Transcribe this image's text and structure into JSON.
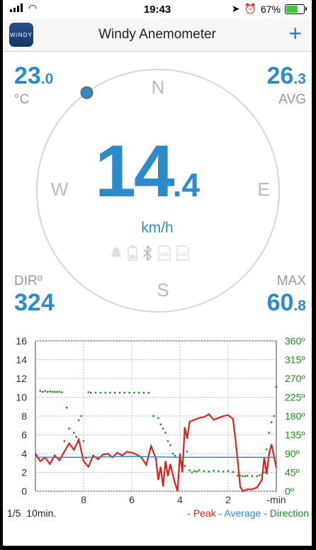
{
  "status": {
    "time": "19:43",
    "battery": "67%",
    "battery_level": 0.67
  },
  "header": {
    "app_icon": "WINDY",
    "title": "Windy Anemometer",
    "add": "+"
  },
  "readings": {
    "temp_int": "23",
    "temp_dec": ".0",
    "temp_unit": "°C",
    "avg_int": "26",
    "avg_dec": ".3",
    "avg_label": "AVG",
    "speed_int": "14",
    "speed_dec": ".4",
    "speed_unit": "km/h",
    "dir_label": "DIRº",
    "dir_value": "324",
    "max_label": "MAX",
    "max_int": "60",
    "max_dec": ".8",
    "direction_deg": 324
  },
  "compass": {
    "n": "N",
    "e": "E",
    "s": "S",
    "w": "W"
  },
  "status_icons": [
    "bell-icon",
    "battery-icon",
    "bluetooth-icon",
    "live-icon",
    "log-icon"
  ],
  "colors": {
    "accent": "#2e8bc9",
    "peak": "#e02020",
    "average": "#2e8bc9",
    "direction": "#1a8a1a"
  },
  "chart_data": {
    "type": "line",
    "x_label": "-min",
    "xlim": [
      -10,
      0
    ],
    "ylim_left": [
      0,
      16
    ],
    "ylim_right": [
      0,
      360
    ],
    "left_ticks": [
      "0",
      "2",
      "4",
      "6",
      "8",
      "10",
      "12",
      "14",
      "16"
    ],
    "right_ticks": [
      "0º",
      "45º",
      "90º",
      "135º",
      "180º",
      "225º",
      "270º",
      "315º",
      "360º"
    ],
    "x_ticks": [
      {
        "v": -8,
        "l": "8"
      },
      {
        "v": -6,
        "l": "6"
      },
      {
        "v": -4,
        "l": "4"
      },
      {
        "v": -2,
        "l": "2"
      },
      {
        "v": 0,
        "l": "-min"
      }
    ],
    "series": [
      {
        "name": "Peak",
        "color": "#e02020",
        "x": [
          -10,
          -9.8,
          -9.6,
          -9.4,
          -9.2,
          -9.0,
          -8.8,
          -8.6,
          -8.4,
          -8.2,
          -8.0,
          -7.8,
          -7.6,
          -7.4,
          -7.2,
          -7.0,
          -6.8,
          -6.6,
          -6.4,
          -6.2,
          -6.0,
          -5.8,
          -5.6,
          -5.4,
          -5.2,
          -5.0,
          -4.9,
          -4.8,
          -4.7,
          -4.6,
          -4.5,
          -4.4,
          -4.3,
          -4.2,
          -4.1,
          -4.0,
          -3.9,
          -3.8,
          -3.7,
          -3.6,
          -3.4,
          -3.2,
          -3.0,
          -2.8,
          -2.6,
          -2.4,
          -2.2,
          -2.0,
          -1.8,
          -1.7,
          -1.6,
          -1.5,
          -1.4,
          -1.2,
          -1.0,
          -0.8,
          -0.6,
          -0.5,
          -0.4,
          -0.3,
          -0.2,
          0
        ],
        "y": [
          4,
          3.2,
          3.6,
          2.9,
          3.8,
          3.3,
          4.2,
          5.1,
          4.4,
          5.5,
          3.2,
          2.6,
          3.8,
          3.4,
          3.9,
          4.0,
          3.6,
          4.1,
          3.8,
          4.2,
          4.1,
          3.9,
          3.6,
          2.8,
          4.8,
          3.5,
          1.2,
          2.6,
          0.5,
          3.2,
          1.6,
          2.9,
          1.8,
          0.8,
          0,
          4.0,
          2.0,
          6.8,
          5.6,
          7.4,
          7.6,
          7.8,
          7.9,
          8.2,
          7.6,
          7.8,
          8.0,
          8.1,
          7.7,
          5.6,
          3.2,
          0.5,
          0,
          0.2,
          0.2,
          0.4,
          1.2,
          3.6,
          1.8,
          4.0,
          5.0,
          2.5
        ]
      },
      {
        "name": "Average",
        "color": "#2e8bc9",
        "x": [
          -10,
          -8,
          -6,
          -4,
          -2,
          0
        ],
        "y": [
          3.6,
          3.6,
          3.7,
          3.6,
          3.6,
          3.6
        ]
      },
      {
        "name": "Direction",
        "color": "#1a8a1a",
        "x": [
          -9.8,
          -9.7,
          -9.6,
          -9.5,
          -9.4,
          -9.3,
          -9.2,
          -9.1,
          -9.0,
          -8.9,
          -8.8,
          -8.7,
          -8.6,
          -8.4,
          -8.3,
          -8.2,
          -8.1,
          -8.0,
          -7.9,
          -7.8,
          -7.7,
          -7.5,
          -7.3,
          -7.1,
          -6.9,
          -6.7,
          -6.5,
          -6.3,
          -6.1,
          -5.9,
          -5.7,
          -5.5,
          -5.3,
          -5.1,
          -4.9,
          -4.8,
          -4.7,
          -4.6,
          -4.5,
          -4.4,
          -4.3,
          -4.2,
          -4.0,
          -3.9,
          -3.8,
          -3.7,
          -3.6,
          -3.5,
          -3.4,
          -3.3,
          -3.2,
          -3.0,
          -2.8,
          -2.6,
          -2.4,
          -2.2,
          -2.0,
          -1.8,
          -1.6,
          -1.5,
          -1.4,
          -1.3,
          -1.2,
          -1.0,
          -0.8,
          -0.7,
          -0.6,
          -0.5,
          -0.4,
          -0.3,
          -0.2,
          -0.1,
          0
        ],
        "y": [
          240,
          238,
          240,
          238,
          239,
          238,
          238,
          238,
          238,
          237,
          120,
          200,
          150,
          140,
          130,
          170,
          180,
          120,
          80,
          237,
          236,
          236,
          236,
          236,
          236,
          236,
          236,
          236,
          236,
          236,
          236,
          236,
          236,
          180,
          175,
          160,
          150,
          140,
          120,
          110,
          90,
          85,
          75,
          70,
          60,
          95,
          50,
          45,
          48,
          47,
          50,
          48,
          47,
          49,
          48,
          47,
          48,
          46,
          37,
          37,
          36,
          36,
          37,
          36,
          36,
          38,
          40,
          45,
          100,
          140,
          165,
          180,
          250
        ]
      }
    ]
  },
  "footer": {
    "page": "1/5",
    "range": "10min.",
    "peak": "- Peak",
    "average": "- Average",
    "direction": "- Direction"
  }
}
